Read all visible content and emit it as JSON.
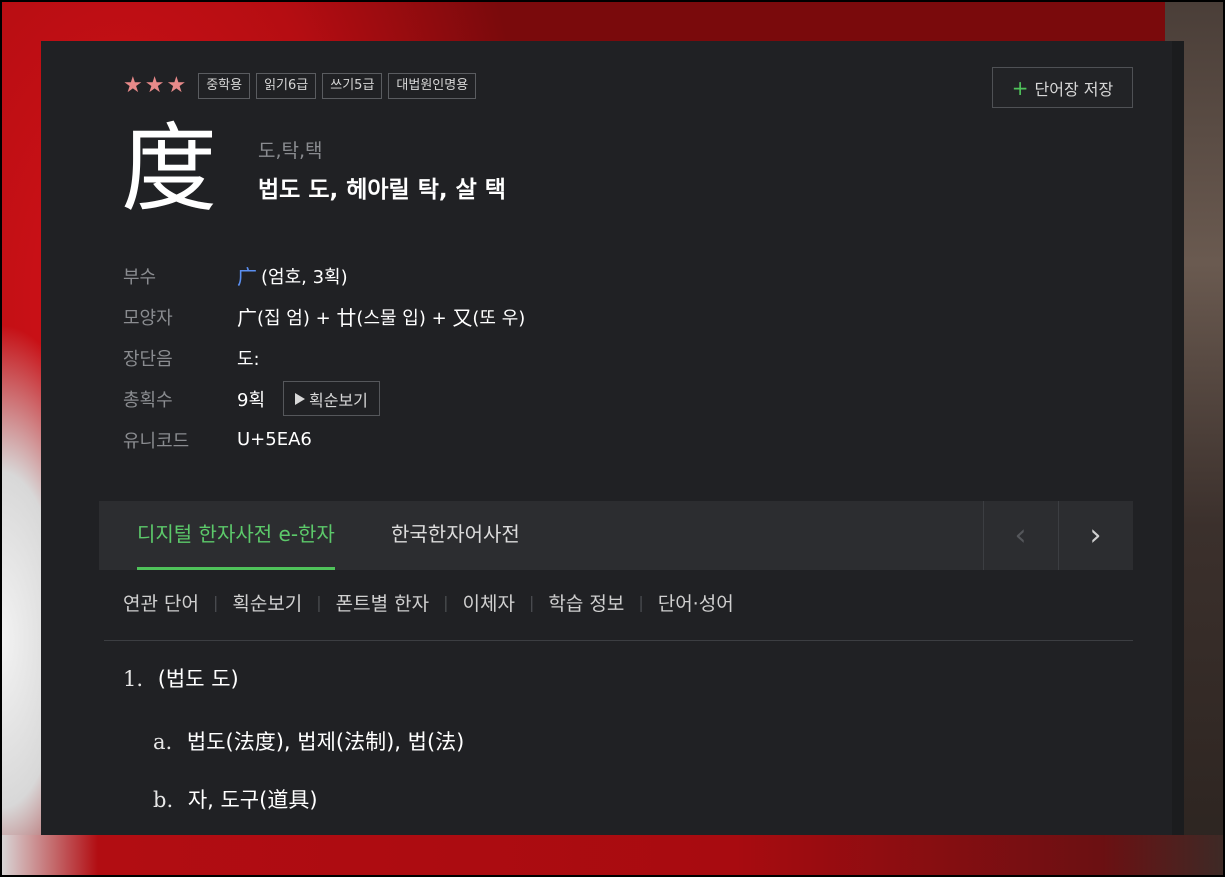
{
  "header": {
    "stars": [
      "★",
      "★",
      "★"
    ],
    "tags": [
      "중학용",
      "읽기6급",
      "쓰기5급",
      "대법원인명용"
    ],
    "save_label": "단어장 저장",
    "save_icon": "+"
  },
  "entry": {
    "hanja": "度",
    "readings": "도,탁,택",
    "meaning_summary": "법도 도, 헤아릴 탁, 살 택"
  },
  "info": {
    "radical_label": "부수",
    "radical_char": "广",
    "radical_desc": "(엄호, 3획)",
    "shape_label": "모양자",
    "shape_part1": "广",
    "shape_part1_desc": "(집 엄) + ",
    "shape_part2": "廿",
    "shape_part2_desc": "(스물 입) + ",
    "shape_part3": "又",
    "shape_part3_desc": "(또 우)",
    "length_label": "장단음",
    "length_value": "도:",
    "strokes_label": "총획수",
    "strokes_value": "9획",
    "stroke_order_btn": "획순보기",
    "unicode_label": "유니코드",
    "unicode_value": "U+5EA6"
  },
  "tabs": {
    "active": "디지털 한자사전 e-한자",
    "other": "한국한자어사전",
    "prev_icon": "‹",
    "next_icon": "›"
  },
  "submenu": [
    "연관 단어",
    "획순보기",
    "폰트별 한자",
    "이체자",
    "학습 정보",
    "단어·성어"
  ],
  "meanings": {
    "m1_idx": "1.",
    "m1_text": "(법도 도)",
    "a_idx": "a.",
    "a_text": "법도(法度), 법제(法制), 법(法)",
    "b_idx": "b.",
    "b_text": "자, 도구(道具)"
  }
}
